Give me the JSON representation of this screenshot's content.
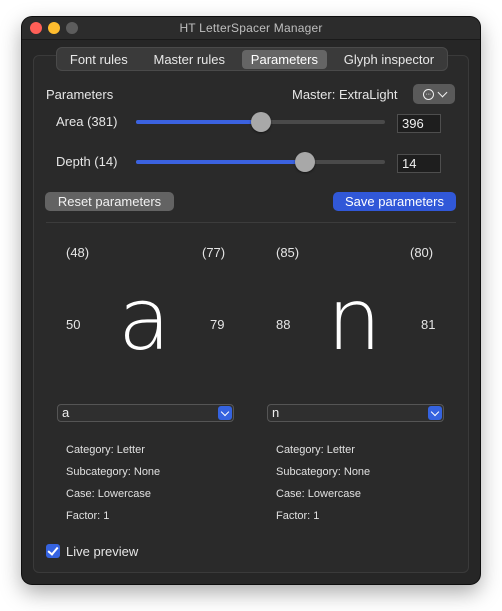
{
  "window": {
    "title": "HT LetterSpacer Manager"
  },
  "tabs": [
    {
      "label": "Font rules",
      "active": false
    },
    {
      "label": "Master rules",
      "active": false
    },
    {
      "label": "Parameters",
      "active": true
    },
    {
      "label": "Glyph inspector",
      "active": false
    }
  ],
  "parameters": {
    "section_label": "Parameters",
    "master_label": "Master: ExtraLight",
    "area": {
      "label": "Area (381)",
      "value": "396",
      "slider_fraction": 0.5
    },
    "depth": {
      "label": "Depth (14)",
      "value": "14",
      "slider_fraction": 0.68
    },
    "reset_label": "Reset parameters",
    "save_label": "Save parameters"
  },
  "preview": {
    "left": {
      "glyph": "a",
      "top_left": "(48)",
      "top_right": "(77)",
      "left_margin": "50",
      "right_margin": "79",
      "selected": "a",
      "category": "Category: Letter",
      "subcategory": "Subcategory: None",
      "case": "Case: Lowercase",
      "factor": "Factor: 1"
    },
    "right": {
      "glyph": "n",
      "top_left": "(85)",
      "top_right": "(80)",
      "left_margin": "88",
      "right_margin": "81",
      "selected": "n",
      "category": "Category: Letter",
      "subcategory": "Subcategory: None",
      "case": "Case: Lowercase",
      "factor": "Factor: 1"
    }
  },
  "live_preview": {
    "label": "Live preview",
    "checked": true
  },
  "colors": {
    "accent": "#3563e0",
    "background": "#262626"
  }
}
